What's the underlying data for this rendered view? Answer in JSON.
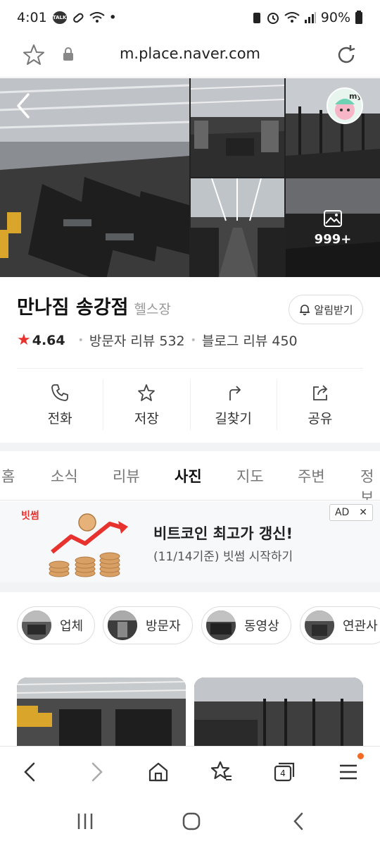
{
  "status_bar": {
    "time": "4:01",
    "talk_badge": "TALK",
    "dot": "•",
    "battery": "90%"
  },
  "browser": {
    "url": "m.place.naver.com"
  },
  "photos": {
    "more_count": "999+"
  },
  "place": {
    "name": "만나짐 송강점",
    "category": "헬스장",
    "alert_label": "알림받기",
    "rating": "4.64",
    "visitor_reviews": "방문자 리뷰 532",
    "blog_reviews": "블로그 리뷰 450"
  },
  "actions": [
    {
      "label": "전화",
      "icon": "phone-icon"
    },
    {
      "label": "저장",
      "icon": "star-icon"
    },
    {
      "label": "길찾기",
      "icon": "directions-icon"
    },
    {
      "label": "공유",
      "icon": "share-icon"
    }
  ],
  "tabs": [
    "홈",
    "소식",
    "리뷰",
    "사진",
    "지도",
    "주변",
    "정보"
  ],
  "active_tab": "사진",
  "ad": {
    "brand": "빗썸",
    "headline": "비트코인 최고가 갱신!",
    "sub": "(11/14기준) 빗썸 시작하기",
    "tag": "AD",
    "close": "✕"
  },
  "chips": [
    "업체",
    "방문자",
    "동영상",
    "연관사"
  ],
  "bottom_nav": {
    "tab_count": "4"
  },
  "colors": {
    "star": "#e8322e",
    "notif": "#f36b22",
    "ad_brand": "#e8322e"
  }
}
